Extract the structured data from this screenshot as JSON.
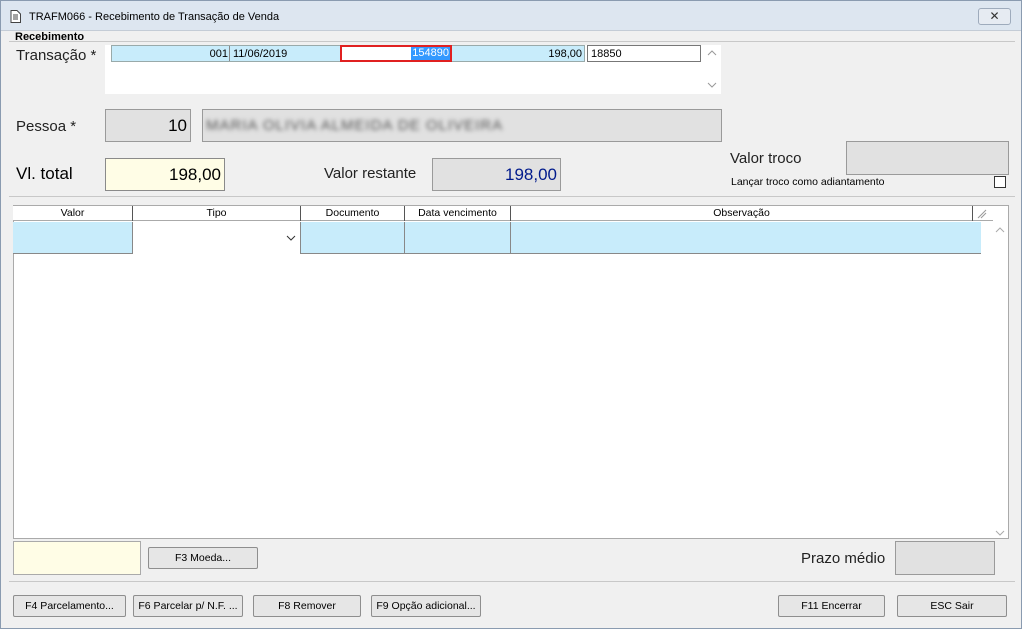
{
  "window": {
    "title": "TRAFM066 - Recebimento de Transação de Venda",
    "close_label": "✕"
  },
  "section": {
    "title": "Recebimento"
  },
  "transacao": {
    "label": "Transação *",
    "seq": "001",
    "date": "11/06/2019",
    "selected_number": "154890",
    "value": "198,00",
    "code": "18850"
  },
  "pessoa": {
    "label": "Pessoa *",
    "id": "10",
    "name": "MARIA OLIVIA ALMEIDA DE OLIVEIRA"
  },
  "total": {
    "label": "Vl. total",
    "value": "198,00"
  },
  "restante": {
    "label": "Valor restante",
    "value": "198,00"
  },
  "troco": {
    "label": "Valor troco",
    "value": "",
    "adiantamento_label": "Lançar troco como adiantamento",
    "adiantamento_checked": false
  },
  "grid": {
    "headers": [
      "Valor",
      "Tipo",
      "Documento",
      "Data vencimento",
      "Observação"
    ]
  },
  "bottom": {
    "moeda_button": "F3 Moeda...",
    "prazo_label": "Prazo médio",
    "prazo_value": ""
  },
  "footer": {
    "b1": "F4 Parcelamento...",
    "b2": "F6 Parcelar p/ N.F. ...",
    "b3": "F8 Remover",
    "b4": "F9 Opção adicional...",
    "b5": "F11 Encerrar",
    "b6": "ESC Sair"
  },
  "colors": {
    "highlight_row": "#c8ecfb",
    "selection": "#3399ff",
    "selection_border": "#e02020",
    "total_bg": "#fffde6",
    "restante_text": "#001a8c"
  }
}
